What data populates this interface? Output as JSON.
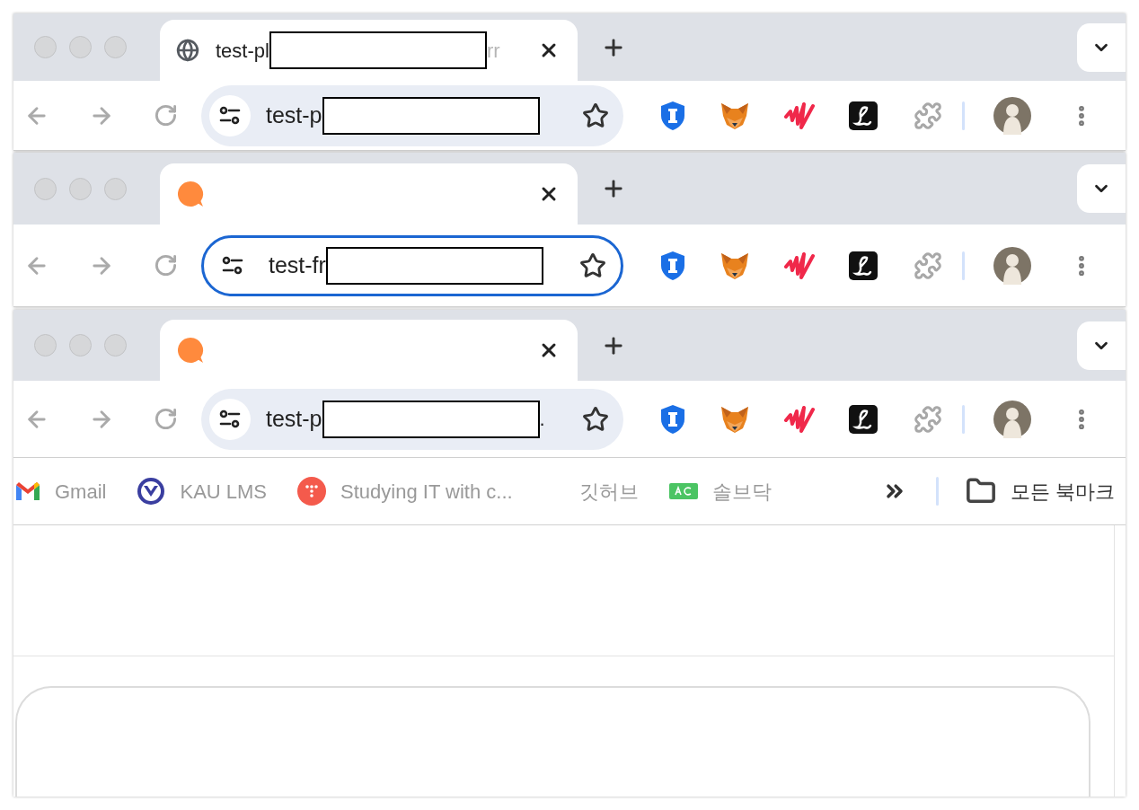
{
  "windows": [
    {
      "tab": {
        "kind": "globe",
        "title": "test-pl",
        "title_tail": "rr"
      },
      "address": {
        "text": "test-p",
        "focused": false
      }
    },
    {
      "tab": {
        "kind": "chat"
      },
      "address": {
        "text": "test-fr",
        "focused": true
      }
    },
    {
      "tab": {
        "kind": "chat"
      },
      "address": {
        "text": "test-p",
        "tail": ".",
        "focused": false
      },
      "bookmarks": {
        "items": [
          {
            "kind": "gmail",
            "label": "Gmail"
          },
          {
            "kind": "seal",
            "label": "KAU LMS"
          },
          {
            "kind": "dots",
            "label": "Studying IT with c..."
          },
          {
            "kind": "plain",
            "label": "깃허브"
          },
          {
            "kind": "ac",
            "label": "솔브닥"
          }
        ],
        "all_bookmarks": "모든 북마크"
      }
    }
  ]
}
